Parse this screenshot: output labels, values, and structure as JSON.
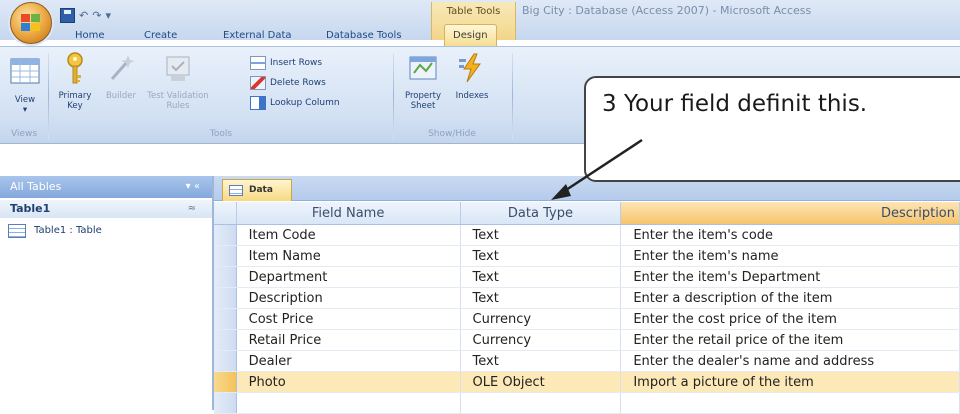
{
  "window": {
    "context_tab_label": "Table Tools",
    "title": "Big City : Database (Access 2007) - Microsoft Access"
  },
  "quick_access": {
    "customize_glyph": "▾"
  },
  "ribbon_tabs": [
    {
      "label": "Home"
    },
    {
      "label": "Create"
    },
    {
      "label": "External Data"
    },
    {
      "label": "Database Tools"
    },
    {
      "label": "Design"
    }
  ],
  "ribbon": {
    "groups": {
      "views": "Views",
      "tools": "Tools",
      "show_hide": "Show/Hide"
    },
    "buttons": {
      "view": "View",
      "primary_key": "Primary Key",
      "builder": "Builder",
      "test_validation_rules": "Test Validation Rules",
      "insert_rows": "Insert Rows",
      "delete_rows": "Delete Rows",
      "lookup_column": "Lookup Column",
      "property_sheet": "Property Sheet",
      "indexes": "Indexes"
    },
    "icons": {
      "view": "datasheet-view-icon",
      "primary_key": "key-icon",
      "builder": "builder-wand-icon",
      "test_validation": "validation-icon",
      "insert_rows": "insert-rows-icon",
      "delete_rows": "delete-rows-icon",
      "lookup_column": "lookup-column-icon",
      "property_sheet": "property-sheet-icon",
      "indexes": "indexes-lightning-icon"
    }
  },
  "callout": {
    "text": "3 Your field definit this."
  },
  "nav_pane": {
    "header": "All Tables",
    "header_controls": "▾ «",
    "group": "Table1",
    "group_control": "≈",
    "item": "Table1 : Table"
  },
  "document": {
    "tab_label": "Data",
    "columns": {
      "field_name": "Field Name",
      "data_type": "Data Type",
      "description": "Description"
    },
    "rows": [
      {
        "field_name": "Item Code",
        "data_type": "Text",
        "description": "Enter the item's code"
      },
      {
        "field_name": "Item Name",
        "data_type": "Text",
        "description": "Enter the item's name"
      },
      {
        "field_name": "Department",
        "data_type": "Text",
        "description": "Enter the item's Department"
      },
      {
        "field_name": "Description",
        "data_type": "Text",
        "description": "Enter a description of the item"
      },
      {
        "field_name": "Cost Price",
        "data_type": "Currency",
        "description": "Enter the cost price of the item"
      },
      {
        "field_name": "Retail Price",
        "data_type": "Currency",
        "description": "Enter the retail price of the item"
      },
      {
        "field_name": "Dealer",
        "data_type": "Text",
        "description": "Enter the dealer's name and address"
      },
      {
        "field_name": "Photo",
        "data_type": "OLE Object",
        "description": "Import a picture of the item"
      },
      {
        "field_name": "",
        "data_type": "",
        "description": ""
      }
    ],
    "current_row_index": 7
  },
  "colors": {
    "ribbon_bg": "#d3e1f3",
    "context_tab": "#f3d58a",
    "selected_row": "#fde9b8",
    "header_blue": "#84a8dc"
  }
}
